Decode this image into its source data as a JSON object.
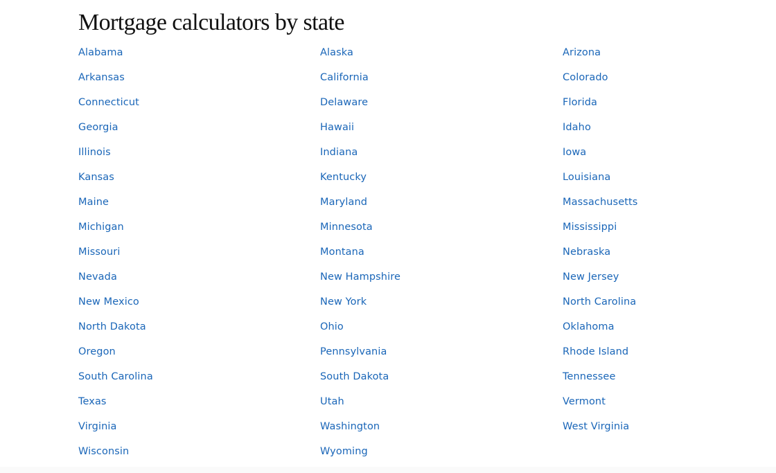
{
  "page": {
    "title": "Mortgage calculators by state",
    "link_color": "#1a66b8"
  },
  "states": [
    {
      "label": "Alabama"
    },
    {
      "label": "Alaska"
    },
    {
      "label": "Arizona"
    },
    {
      "label": "Arkansas"
    },
    {
      "label": "California"
    },
    {
      "label": "Colorado"
    },
    {
      "label": "Connecticut"
    },
    {
      "label": "Delaware"
    },
    {
      "label": "Florida"
    },
    {
      "label": "Georgia"
    },
    {
      "label": "Hawaii"
    },
    {
      "label": "Idaho"
    },
    {
      "label": "Illinois"
    },
    {
      "label": "Indiana"
    },
    {
      "label": "Iowa"
    },
    {
      "label": "Kansas"
    },
    {
      "label": "Kentucky"
    },
    {
      "label": "Louisiana"
    },
    {
      "label": "Maine"
    },
    {
      "label": "Maryland"
    },
    {
      "label": "Massachusetts"
    },
    {
      "label": "Michigan"
    },
    {
      "label": "Minnesota"
    },
    {
      "label": "Mississippi"
    },
    {
      "label": "Missouri"
    },
    {
      "label": "Montana"
    },
    {
      "label": "Nebraska"
    },
    {
      "label": "Nevada"
    },
    {
      "label": "New Hampshire"
    },
    {
      "label": "New Jersey"
    },
    {
      "label": "New Mexico"
    },
    {
      "label": "New York"
    },
    {
      "label": "North Carolina"
    },
    {
      "label": "North Dakota"
    },
    {
      "label": "Ohio"
    },
    {
      "label": "Oklahoma"
    },
    {
      "label": "Oregon"
    },
    {
      "label": "Pennsylvania"
    },
    {
      "label": "Rhode Island"
    },
    {
      "label": "South Carolina"
    },
    {
      "label": "South Dakota"
    },
    {
      "label": "Tennessee"
    },
    {
      "label": "Texas"
    },
    {
      "label": "Utah"
    },
    {
      "label": "Vermont"
    },
    {
      "label": "Virginia"
    },
    {
      "label": "Washington"
    },
    {
      "label": "West Virginia"
    },
    {
      "label": "Wisconsin"
    },
    {
      "label": "Wyoming"
    }
  ]
}
